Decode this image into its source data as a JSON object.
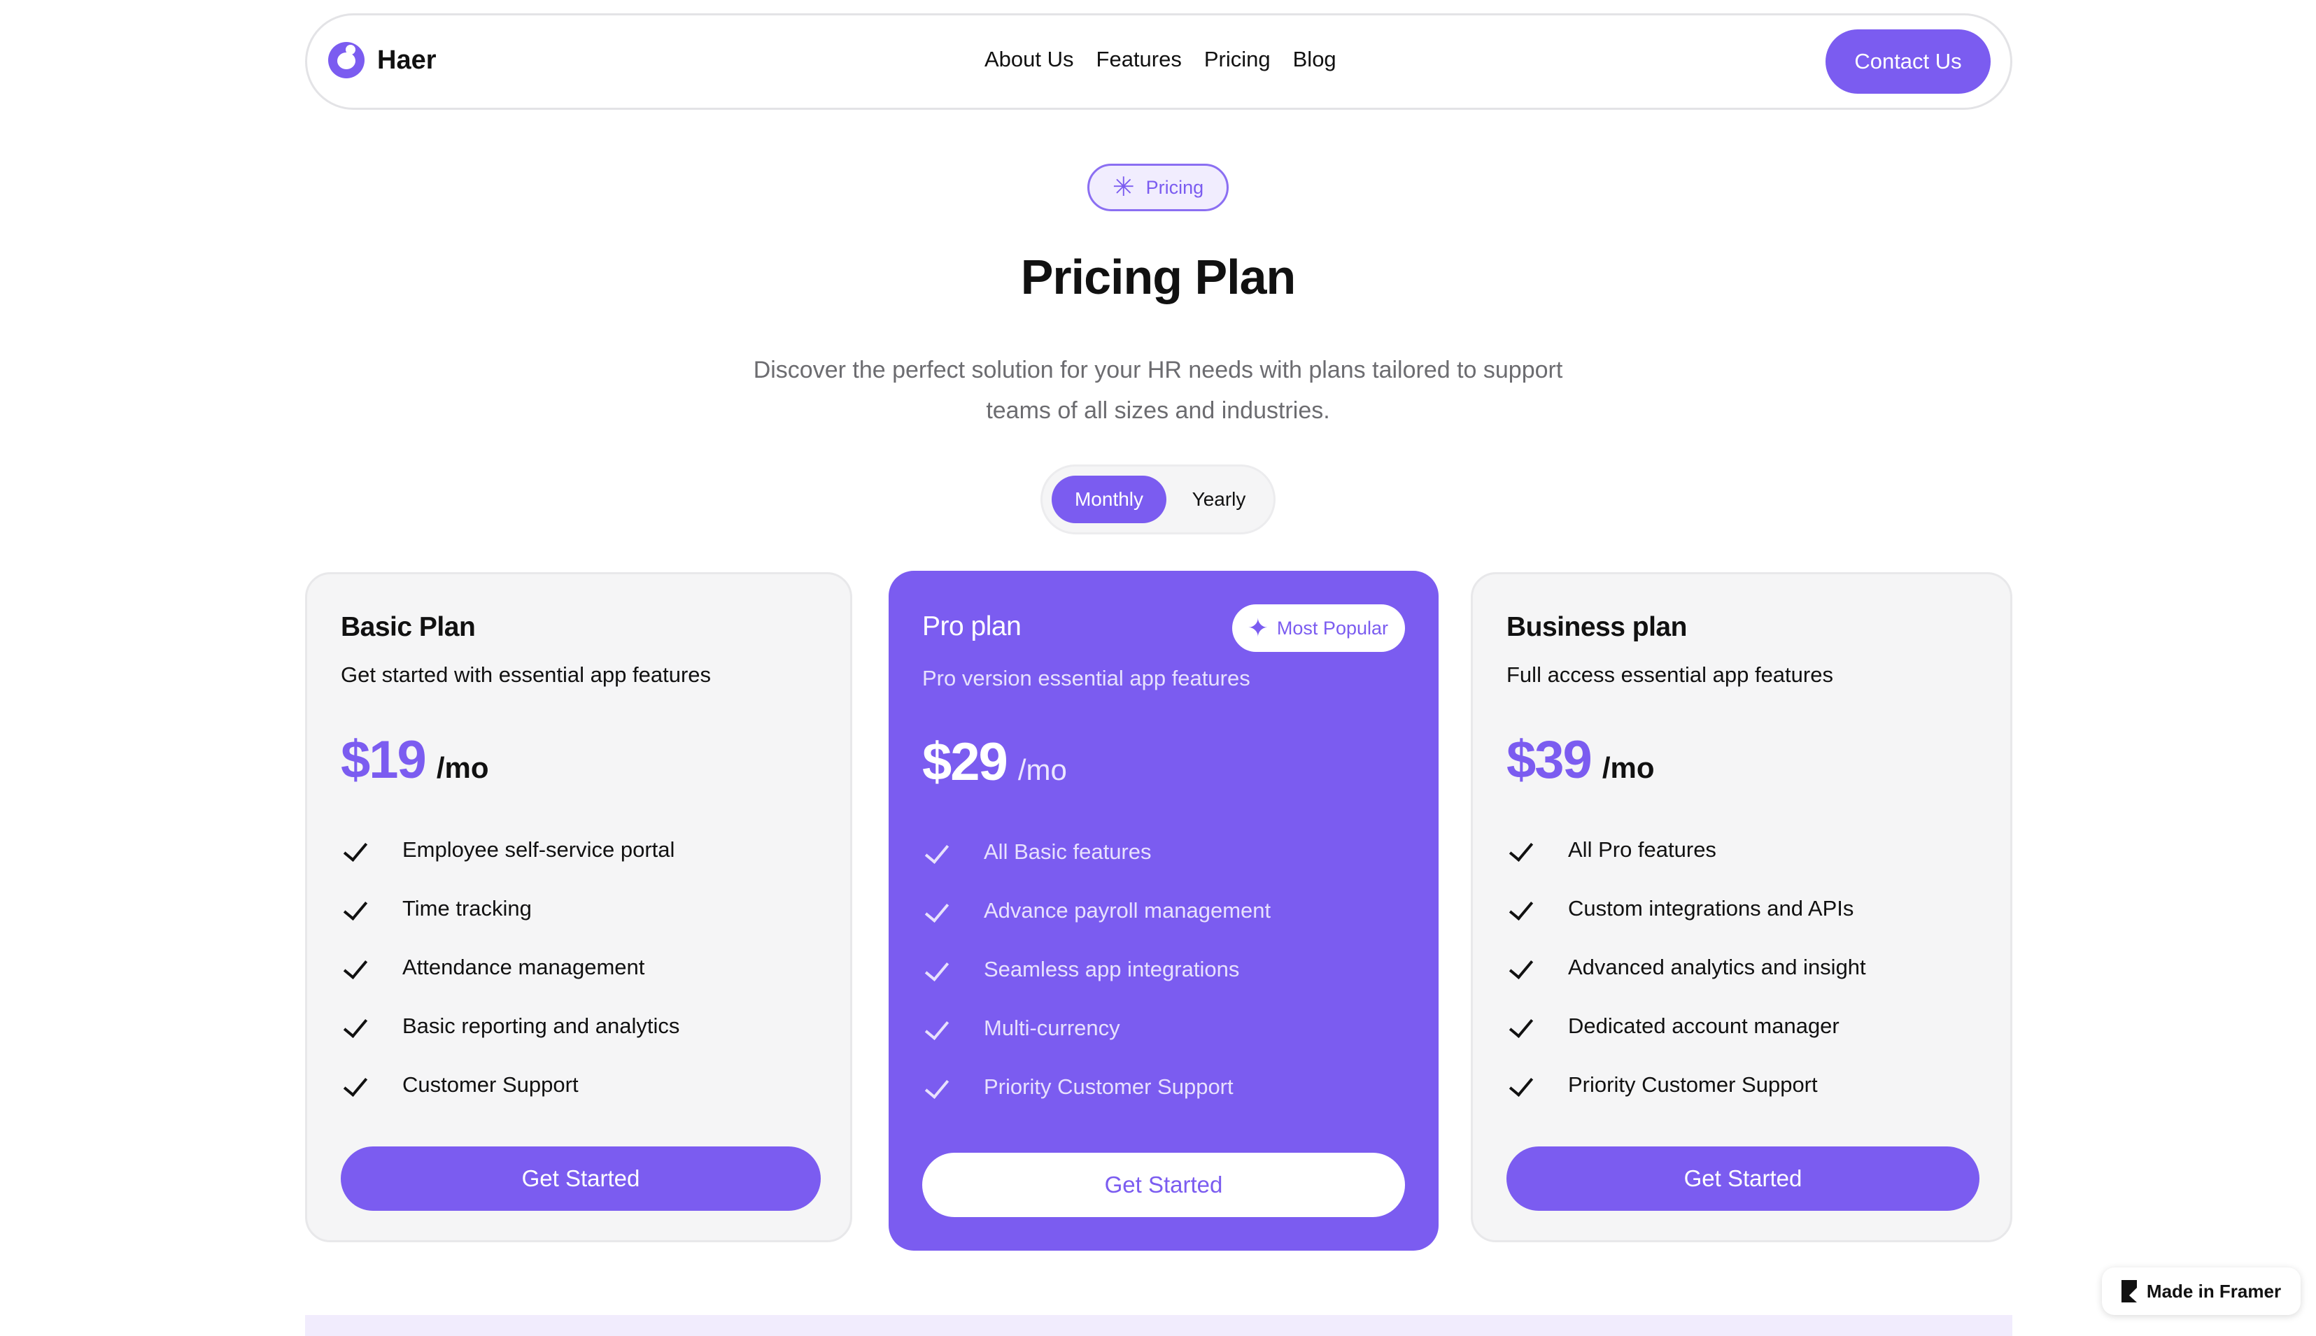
{
  "nav": {
    "brand": "Haer",
    "links": [
      "About Us",
      "Features",
      "Pricing",
      "Blog"
    ],
    "cta": "Contact Us"
  },
  "hero": {
    "badge": "Pricing",
    "title": "Pricing Plan",
    "subtitle": "Discover the perfect solution for your HR needs with plans tailored to support teams of all sizes and industries.",
    "billing_toggle": {
      "selected": "Monthly",
      "options": [
        "Monthly",
        "Yearly"
      ]
    }
  },
  "plans": [
    {
      "name": "Basic Plan",
      "description": "Get started with essential app features",
      "price": "$19",
      "period": "/mo",
      "features": [
        "Employee self-service portal",
        "Time tracking",
        "Attendance management",
        "Basic reporting and analytics",
        "Customer Support"
      ],
      "cta": "Get Started"
    },
    {
      "name": "Pro plan",
      "badge": "Most Popular",
      "description": "Pro version essential app features",
      "price": "$29",
      "period": "/mo",
      "features": [
        "All Basic features",
        "Advance payroll management",
        "Seamless app integrations",
        "Multi-currency",
        "Priority Customer Support"
      ],
      "cta": "Get Started"
    },
    {
      "name": "Business plan",
      "description": "Full access essential app features",
      "price": "$39",
      "period": "/mo",
      "features": [
        "All Pro features",
        "Custom integrations and APIs",
        "Advanced analytics and insight",
        "Dedicated account manager",
        "Priority Customer Support"
      ],
      "cta": "Get Started"
    }
  ],
  "framer_badge": "Made in Framer",
  "colors": {
    "accent": "#7b5cf0",
    "card_bg": "#f5f5f6",
    "text": "#111111",
    "muted": "#6c6c70"
  }
}
